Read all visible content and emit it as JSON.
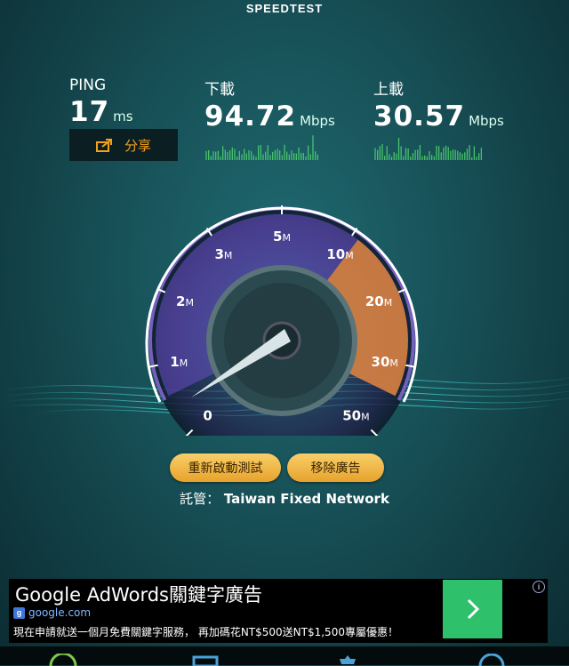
{
  "app": {
    "title": "SPEEDTEST"
  },
  "ping": {
    "label": "PING",
    "value": "17",
    "unit": "ms"
  },
  "download": {
    "label": "下載",
    "value": "94.72",
    "unit": "Mbps"
  },
  "upload": {
    "label": "上載",
    "value": "30.57",
    "unit": "Mbps"
  },
  "share": {
    "label": "分享",
    "icon": "share-icon"
  },
  "gauge": {
    "ticks": [
      {
        "num": "0",
        "unit": ""
      },
      {
        "num": "1",
        "unit": "M"
      },
      {
        "num": "2",
        "unit": "M"
      },
      {
        "num": "3",
        "unit": "M"
      },
      {
        "num": "5",
        "unit": "M"
      },
      {
        "num": "10",
        "unit": "M"
      },
      {
        "num": "20",
        "unit": "M"
      },
      {
        "num": "30",
        "unit": "M"
      },
      {
        "num": "50",
        "unit": "M"
      }
    ],
    "needle_value_mbps": 0,
    "colors": {
      "purple": "#8e6fe0",
      "orange": "#f08c2a",
      "needle": "#d9e4e6"
    }
  },
  "buttons": {
    "restart": "重新啟動測試",
    "remove_ads": "移除廣告"
  },
  "host": {
    "label": "託管：",
    "name": "Taiwan Fixed Network"
  },
  "ad": {
    "title": "Google AdWords關鍵字廣告",
    "domain": "google.com",
    "description": "現在申請就送一個月免費關鍵字服務， 再加碼花NT$500送NT$1,500專屬優惠！",
    "info": "i"
  },
  "nav": {
    "icons": [
      "speed-icon",
      "results-icon",
      "settings-icon",
      "info-icon"
    ]
  }
}
